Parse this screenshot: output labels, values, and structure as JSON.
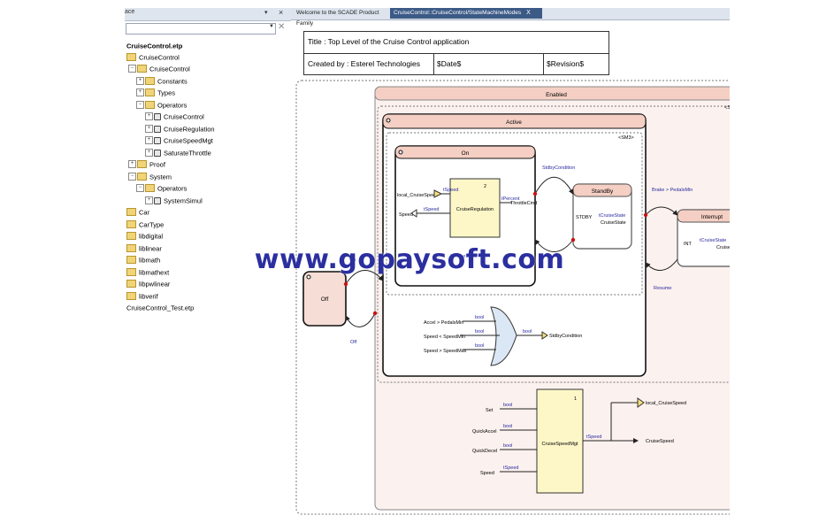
{
  "left_panel": {
    "title": "ace",
    "tree": [
      {
        "label": "CruiseControl.etp"
      },
      {
        "label": "CruiseControl"
      },
      {
        "label": "CruiseControl"
      },
      {
        "label": "Constants"
      },
      {
        "label": "Types"
      },
      {
        "label": "Operators"
      },
      {
        "label": "CruiseControl"
      },
      {
        "label": "CruiseRegulation"
      },
      {
        "label": "CruiseSpeedMgt"
      },
      {
        "label": "SaturateThrottle"
      },
      {
        "label": "Proof"
      },
      {
        "label": "System"
      },
      {
        "label": "Operators"
      },
      {
        "label": "SystemSimul"
      },
      {
        "label": "Car"
      },
      {
        "label": "CarType"
      },
      {
        "label": "libdigital"
      },
      {
        "label": "liblinear"
      },
      {
        "label": "libmath"
      },
      {
        "label": "libmathext"
      },
      {
        "label": "libpwlinear"
      },
      {
        "label": "libverif"
      },
      {
        "label": "CruiseControl_Test.etp"
      }
    ]
  },
  "tabs": [
    {
      "label": "Welcome to the SCADE Product Family"
    },
    {
      "label": "CruiseControl::CruiseControl/StateMachineModes",
      "close": "X"
    }
  ],
  "title_block": {
    "title": "Title : Top Level of the Cruise Control application",
    "created": "Created by : Esterel Technologies",
    "date": "$Date$",
    "revision": "$Revision$"
  },
  "diagram": {
    "enabled": "Enabled",
    "active": "Active",
    "on": "On",
    "off": "Off",
    "standby": "StandBy",
    "interrupt": "Interrupt",
    "sm_tag": "<SM3>",
    "sm_tag2": "<S",
    "cruise_regulation": "CruiseRegulation",
    "cruise_speed_mgt": "CruiseSpeedMgt",
    "local_cruise_speed": "local_CruiseSpeed",
    "speed": "Speed",
    "tspeed": "tSpeed",
    "tpercent": "tPercent",
    "throttle_cmd": "ThrottleCmd",
    "stdby_condition": "StdbyCondition",
    "stdby": "STDBY",
    "int": "INT",
    "tcruise_state": "tCruiseState",
    "cruise_state": "CruiseState",
    "brake_cond": "Brake > PedalsMin",
    "resume": "Resume",
    "on_guard": "On",
    "off_guard": "Off",
    "accel_cond": "Accel > PedalsMin",
    "speed_min": "Speed < SpeedMin",
    "speed_max": "Speed > SpeedMax",
    "bool": "bool",
    "set": "Set",
    "quick_accel": "QuickAccel",
    "quick_decel": "QuickDecel",
    "cruise_speed": "CruiseSpeed",
    "one": "1",
    "two": "2"
  },
  "watermark": "www.gopaysoft.com",
  "colors": {
    "state_fill": "#f6ddd5",
    "header_fill": "#f5cfc3",
    "operator_fill": "#fdf7c8",
    "tab_active": "#3c5a86",
    "link_blue": "#2a2aa0",
    "transition_red": "#cc1111"
  }
}
